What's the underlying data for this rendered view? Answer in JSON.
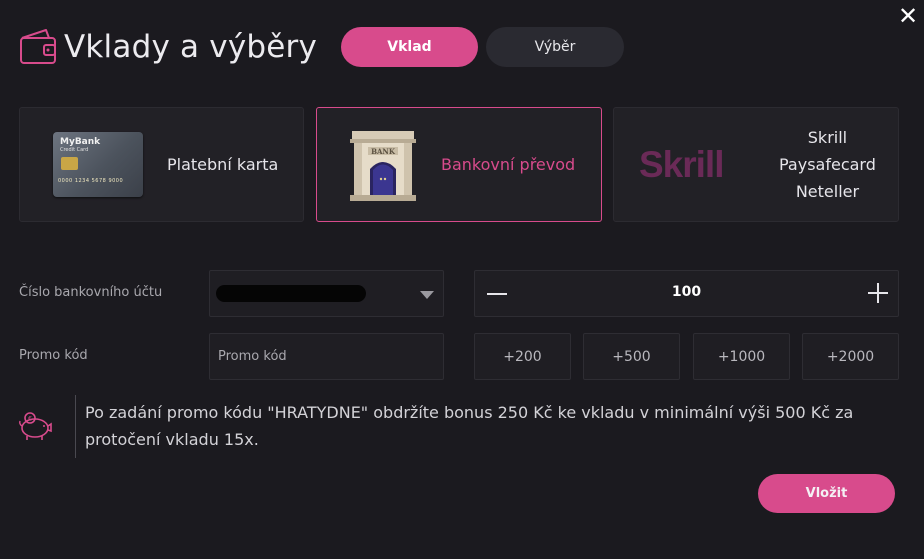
{
  "header": {
    "title": "Vklady a výběry",
    "wallet_icon": "wallet-icon"
  },
  "close_icon": "close-icon",
  "tabs": [
    {
      "label": "Vklad",
      "active": true
    },
    {
      "label": "Výběr",
      "active": false
    }
  ],
  "methods": {
    "card": {
      "label": "Platební karta",
      "card_brand": "MyBank",
      "card_sub": "Credit Card",
      "card_number": "0000 1234 5678 9000"
    },
    "bank": {
      "label": "Bankovní převod",
      "bank_sign": "BANK",
      "selected": true
    },
    "wallets": {
      "logo": "Skrill",
      "items": [
        "Skrill",
        "Paysafecard",
        "Neteller"
      ]
    }
  },
  "form": {
    "account_label": "Číslo bankovního účtu",
    "promo_label": "Promo kód",
    "promo_placeholder": "Promo kód",
    "amount": "100",
    "quick_amounts": [
      "+200",
      "+500",
      "+1000",
      "+2000"
    ]
  },
  "promo_info": {
    "icon": "piggy-bank-icon",
    "text": "Po zadání promo kódu \"HRATYDNE\" obdržíte bonus 250 Kč ke vkladu v minimální výši 500 Kč za protočení vkladu 15x."
  },
  "submit_label": "Vložit",
  "colors": {
    "accent": "#d84b8c",
    "background": "#1b1a1f",
    "panel": "#222126"
  }
}
